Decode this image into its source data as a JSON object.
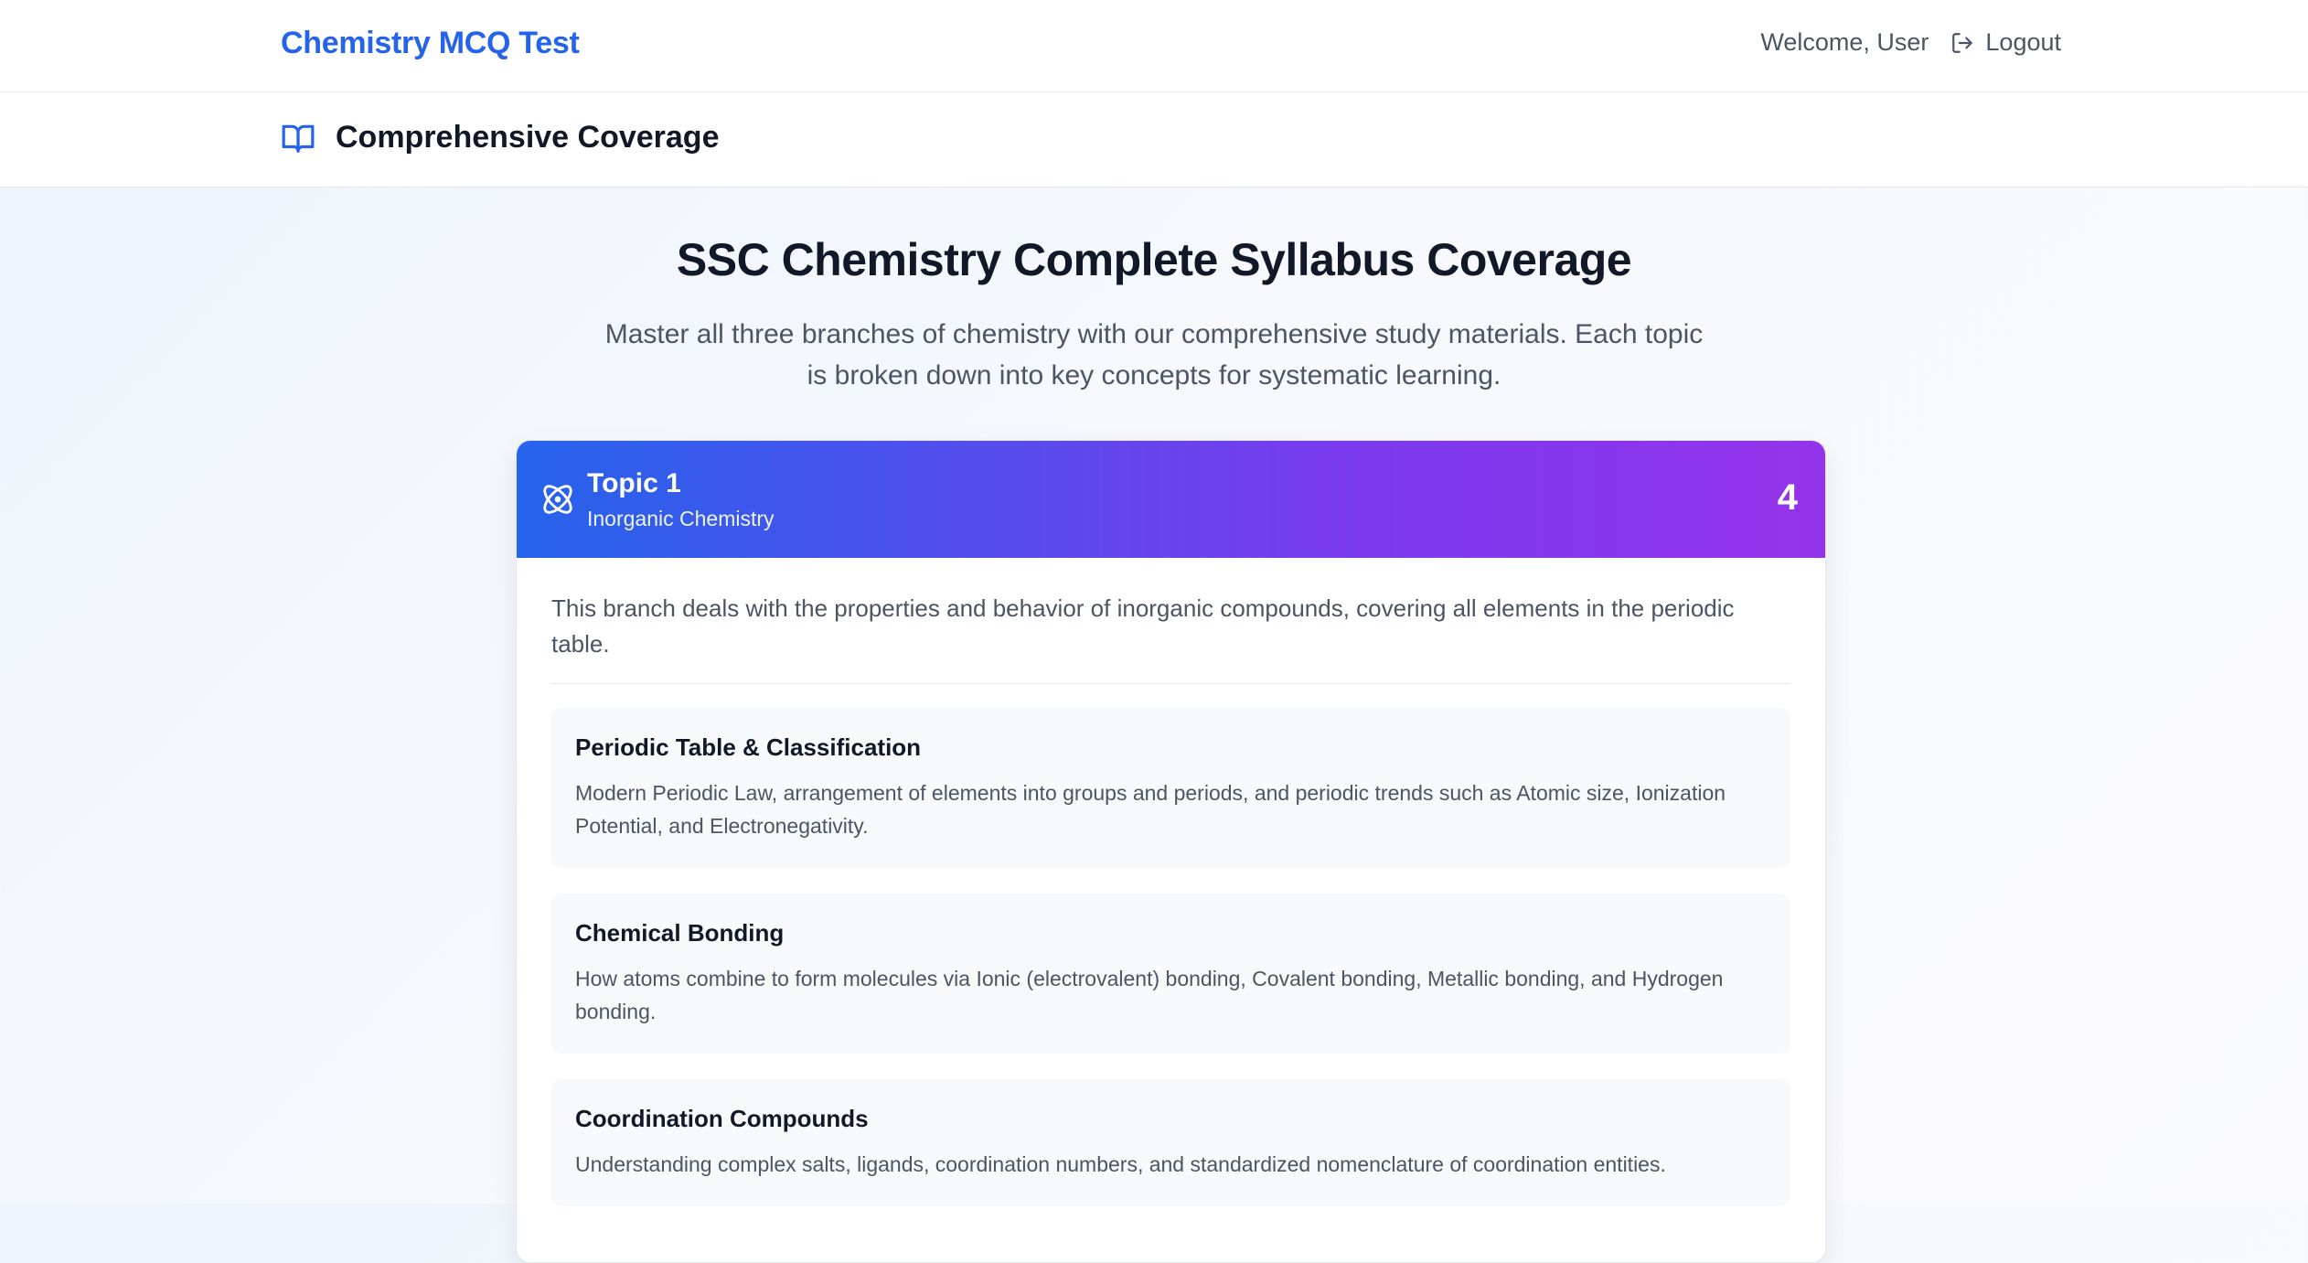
{
  "navbar": {
    "brand": "Chemistry MCQ Test",
    "welcome": "Welcome, User",
    "logout_label": "Logout"
  },
  "subheader": {
    "title": "Comprehensive Coverage"
  },
  "hero": {
    "title": "SSC Chemistry Complete Syllabus Coverage",
    "description": "Master all three branches of chemistry with our comprehensive study materials. Each topic is broken down into key concepts for systematic learning."
  },
  "topic": {
    "title": "Topic 1",
    "subtitle": "Inorganic Chemistry",
    "count": "4",
    "description": "This branch deals with the properties and behavior of inorganic compounds, covering all elements in the periodic table.",
    "concepts": [
      {
        "title": "Periodic Table & Classification",
        "text": "Modern Periodic Law, arrangement of elements into groups and periods, and periodic trends such as Atomic size, Ionization Potential, and Electronegativity."
      },
      {
        "title": "Chemical Bonding",
        "text": "How atoms combine to form molecules via Ionic (electrovalent) bonding, Covalent bonding, Metallic bonding, and Hydrogen bonding."
      },
      {
        "title": "Coordination Compounds",
        "text": "Understanding complex salts, ligands, coordination numbers, and standardized nomenclature of coordination entities."
      }
    ]
  },
  "colors": {
    "brand": "#2563eb",
    "gradient_start": "#2563eb",
    "gradient_end": "#9333ea"
  },
  "icons": {
    "logout": "logout-icon",
    "subheader": "book-open-icon",
    "topic": "atom-icon"
  }
}
